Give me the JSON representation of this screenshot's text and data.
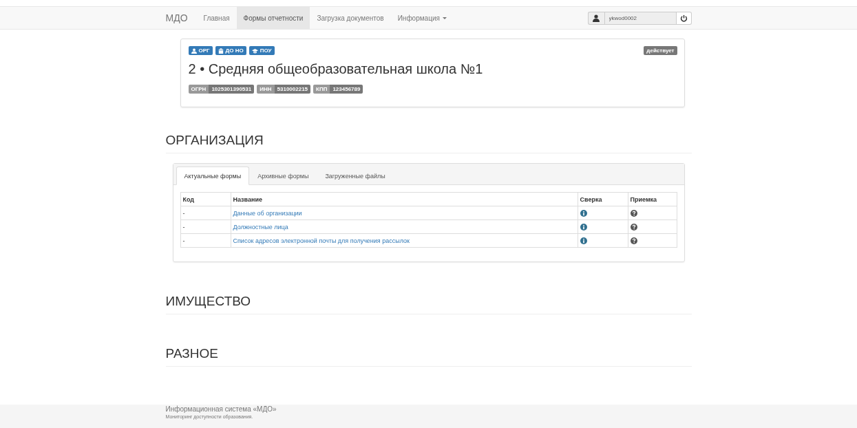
{
  "navbar": {
    "brand": "МДО",
    "items": [
      {
        "label": "Главная",
        "selected": false,
        "dropdown": false
      },
      {
        "label": "Формы отчетности",
        "selected": true,
        "dropdown": false
      },
      {
        "label": "Загрузка документов",
        "selected": false,
        "dropdown": false
      },
      {
        "label": "Информация",
        "selected": false,
        "dropdown": true
      }
    ],
    "user": {
      "value": "ykwod0002"
    }
  },
  "organization": {
    "tags": [
      {
        "label": "ОРГ",
        "kind": "person"
      },
      {
        "label": "ДО НО",
        "kind": "building"
      },
      {
        "label": "ПОУ",
        "kind": "cap"
      }
    ],
    "status": "действует",
    "title": "2 • Средняя общеобразовательная школа №1",
    "ids": [
      {
        "label": "ОГРН",
        "value": "1025301390531"
      },
      {
        "label": "ИНН",
        "value": "5310002215"
      },
      {
        "label": "КПП",
        "value": "123456789"
      }
    ]
  },
  "sections": [
    {
      "title": "ОРГАНИЗАЦИЯ",
      "tabs": [
        {
          "label": "Актуальные формы",
          "selected": true
        },
        {
          "label": "Архивные формы",
          "selected": false
        },
        {
          "label": "Загруженные файлы",
          "selected": false
        }
      ],
      "table": {
        "columns": [
          "Код",
          "Название",
          "Сверка",
          "Приемка"
        ],
        "rows": [
          {
            "code": "-",
            "name": "Данные об организации"
          },
          {
            "code": "-",
            "name": "Должностные лица"
          },
          {
            "code": "-",
            "name": "Список адресов электронной почты для получения рассылок"
          }
        ]
      }
    },
    {
      "title": "ИМУЩЕСТВО"
    },
    {
      "title": "РАЗНОЕ"
    }
  ],
  "footer": {
    "title": "Информационная система «МДО»",
    "subtitle": "Мониторинг доступности образования."
  }
}
